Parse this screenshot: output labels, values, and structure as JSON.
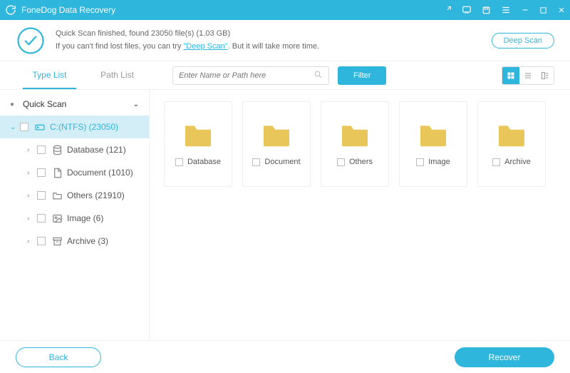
{
  "app": {
    "title": "FoneDog Data Recovery"
  },
  "scan": {
    "summary": "Quick Scan finished, found 23050 file(s) (1.03 GB)",
    "hint_prefix": "If you can't find lost files, you can try ",
    "deep_link": "\"Deep Scan\"",
    "hint_suffix": ". But it will take more time.",
    "deep_button": "Deep Scan"
  },
  "tabs": {
    "type": "Type List",
    "path": "Path List"
  },
  "search": {
    "placeholder": "Enter Name or Path here"
  },
  "filter": {
    "label": "Filter"
  },
  "tree": {
    "root": "Quick Scan",
    "drive": "C:(NTFS) (23050)",
    "items": [
      {
        "label": "Database (121)"
      },
      {
        "label": "Document (1010)"
      },
      {
        "label": "Others (21910)"
      },
      {
        "label": "Image (6)"
      },
      {
        "label": "Archive (3)"
      }
    ]
  },
  "grid": {
    "items": [
      {
        "label": "Database"
      },
      {
        "label": "Document"
      },
      {
        "label": "Others"
      },
      {
        "label": "Image"
      },
      {
        "label": "Archive"
      }
    ]
  },
  "footer": {
    "back": "Back",
    "recover": "Recover"
  }
}
